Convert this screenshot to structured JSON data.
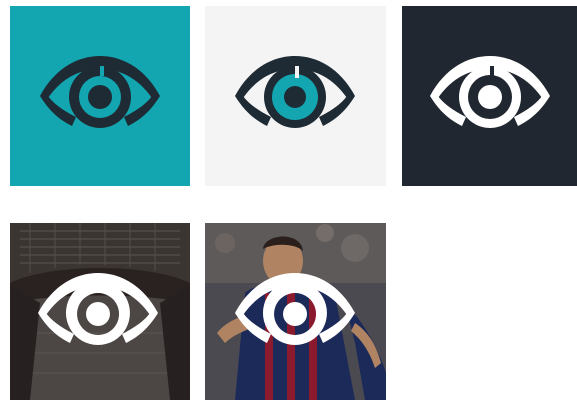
{
  "logo_variants": [
    {
      "background": "#13a6b0",
      "eye_color": "#1e2b35",
      "iris_color": "#1e2b35",
      "pupil_color": "#1e2b35",
      "iris_ring_color": "#13a6b0"
    },
    {
      "background": "#f4f4f4",
      "eye_color": "#1e2b35",
      "iris_color": "#13a6b0",
      "pupil_color": "#1e2b35",
      "iris_ring_color": "#f4f4f4"
    },
    {
      "background": "#212730",
      "eye_color": "#ffffff",
      "iris_color": "#ffffff",
      "pupil_color": "#ffffff",
      "iris_ring_color": "#212730"
    },
    {
      "background": "stadium-photo",
      "eye_color": "#ffffff",
      "iris_color": "#ffffff",
      "pupil_color": "#ffffff",
      "iris_ring_color": "transparent"
    },
    {
      "background": "football-player-photo",
      "eye_color": "#ffffff",
      "iris_color": "#ffffff",
      "pupil_color": "#ffffff",
      "iris_ring_color": "transparent"
    }
  ],
  "icon": "eye-icon"
}
